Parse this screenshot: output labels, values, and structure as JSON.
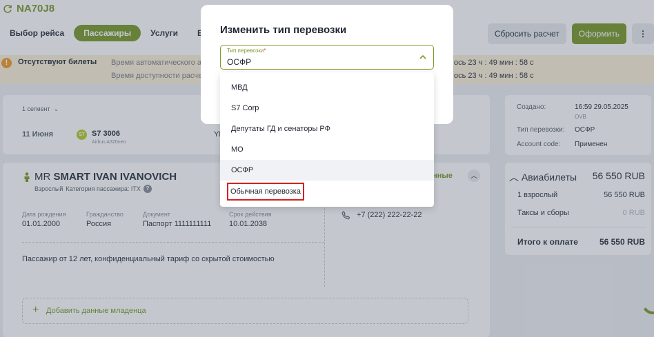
{
  "booking": {
    "code": "NA70J8"
  },
  "nav": {
    "items": [
      {
        "label": "Выбор рейса"
      },
      {
        "label": "Пассажиры"
      },
      {
        "label": "Услуги"
      },
      {
        "label": "Бил"
      }
    ]
  },
  "actions": {
    "reset": "Сбросить расчет",
    "submit": "Оформить",
    "more": "⋮"
  },
  "warning": {
    "title": "Отсутствуют билеты",
    "line1": "Время автоматического ан",
    "line2": "Время доступности расчет",
    "line1_right": "ось 23 ч : 49 мин : 58 с",
    "line2_right": "ось 23 ч : 49 мин : 58 с"
  },
  "segment": {
    "count_label": "1 сегмент",
    "date": "11 Июня",
    "airline_logo": "S7",
    "flight": "S7 3006",
    "aircraft": "Airbus A320neo",
    "fragment_mid": "YK",
    "fragment_right": "m"
  },
  "passenger": {
    "title": "MR",
    "name": "SMART IVAN IVANOVICH",
    "type": "Взрослый",
    "category": "Категория пассажира: ITX",
    "data_link": "анные",
    "fields": [
      {
        "label": "Дата рождения",
        "value": "01.01.2000"
      },
      {
        "label": "Гражданство",
        "value": "Россия"
      },
      {
        "label": "Документ",
        "value": "Паспорт 1111111111"
      },
      {
        "label": "Срок действия",
        "value": "10.01.2038"
      }
    ],
    "phone": "+7 (222) 222-22-22",
    "note": "Пассажир от 12 лет, конфиденциальный тариф со скрытой стоимостью",
    "add_infant": "Добавить данные младенца"
  },
  "info": {
    "created_label": "Создано:",
    "created_value": "16:59 29.05.2025",
    "created_sub": "OVB",
    "transport_type_label": "Тип перевозки:",
    "transport_type_value": "ОСФР",
    "account_code_label": "Account code:",
    "account_code_value": "Применен"
  },
  "price": {
    "header": "Авиабилеты",
    "header_value": "56 550 RUB",
    "rows": [
      {
        "label": "1 взрослый",
        "value": "56 550 RUB"
      },
      {
        "label": "Таксы и сборы",
        "value_num": "0",
        "value_cur": " RUB"
      }
    ],
    "total_label": "Итого к оплате",
    "total_value": "56 550 RUB"
  },
  "modal": {
    "title": "Изменить тип перевозки",
    "select": {
      "label": "Тип перевозки",
      "required_mark": "*",
      "value": "ОСФР"
    },
    "options": [
      {
        "label": "МВД"
      },
      {
        "label": "S7 Corp"
      },
      {
        "label": "Депутаты ГД и сенаторы РФ"
      },
      {
        "label": "МО"
      },
      {
        "label": "ОСФР"
      },
      {
        "label": "Обычная перевозка"
      }
    ]
  },
  "colors": {
    "accent": "#7c9a2c",
    "warning_bg": "#fbefd7",
    "warning_icon": "#f19a2b",
    "highlight_border": "#d32020"
  }
}
